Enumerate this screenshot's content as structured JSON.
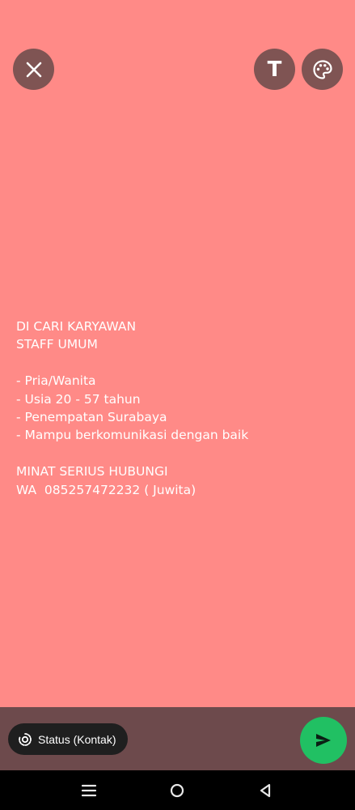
{
  "top_controls": {
    "close_icon": "close-icon",
    "text_tool_label": "T",
    "palette_icon": "palette-icon"
  },
  "status_text": {
    "lines": [
      "DI CARI KARYAWAN",
      "STAFF UMUM",
      "",
      "- Pria/Wanita",
      "- Usia 20 - 57 tahun",
      "- Penempatan Surabaya",
      "- Mampu berkomunikasi dengan baik",
      "",
      "MINAT SERIUS HUBUNGI",
      "WA  085257472232 ( Juwita)"
    ]
  },
  "bottom_bar": {
    "audience_label": "Status (Kontak)",
    "audience_icon": "status-ring-icon",
    "send_icon": "send-icon"
  },
  "nav_bar": {
    "menu_icon": "recent-apps-icon",
    "home_icon": "home-icon",
    "back_icon": "back-icon"
  },
  "colors": {
    "background": "#ff8a87",
    "button_bg": "#7f5453",
    "bottom_bar": "#6d4a4c",
    "send_button": "#21c063",
    "pill_bg": "#1f1f1f"
  }
}
